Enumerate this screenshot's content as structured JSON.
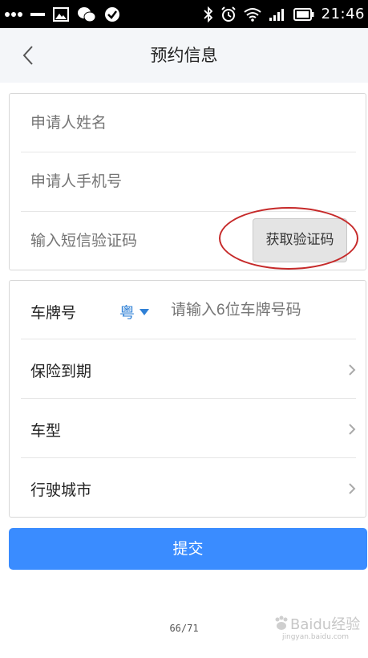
{
  "status_bar": {
    "time": "21:46",
    "left_icons": [
      "dots-icon",
      "minus-icon",
      "image-icon",
      "wechat-icon",
      "check-circle-icon"
    ],
    "right_icons": [
      "bluetooth-icon",
      "alarm-icon",
      "wifi-icon",
      "signal-icon",
      "battery-icon"
    ]
  },
  "header": {
    "title": "预约信息",
    "back_icon": "chevron-left-icon"
  },
  "applicant": {
    "name_placeholder": "申请人姓名",
    "phone_placeholder": "申请人手机号",
    "sms_placeholder": "输入短信验证码",
    "get_code_label": "获取验证码"
  },
  "vehicle": {
    "plate_label": "车牌号",
    "province": "粤",
    "plate_placeholder": "请输入6位车牌号码",
    "rows": [
      {
        "label": "保险到期"
      },
      {
        "label": "车型"
      },
      {
        "label": "行驶城市"
      }
    ]
  },
  "submit_label": "提交",
  "page_indicator": "66/71",
  "watermark": {
    "text": "Baidu经验",
    "sub": "jingyan.baidu.com"
  },
  "colors": {
    "accent": "#3a8cff",
    "province_blue": "#2f80d6",
    "annotation_red": "#c62a2a",
    "placeholder": "#b4b4b4"
  }
}
